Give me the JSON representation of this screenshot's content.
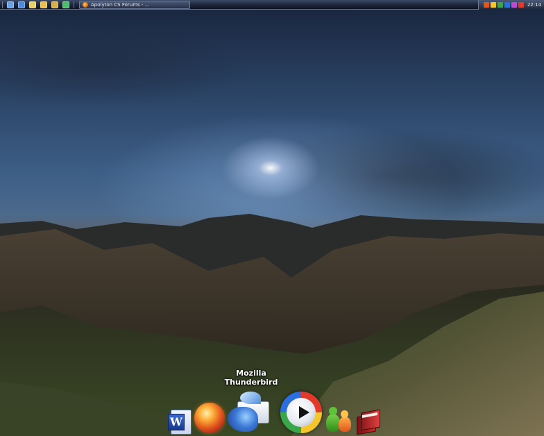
{
  "taskbar": {
    "quick_launch": [
      {
        "name": "show-desktop",
        "color": "#6aa0e8"
      },
      {
        "name": "help",
        "color": "#4a8ae0"
      },
      {
        "name": "folder",
        "color": "#e8d06a"
      },
      {
        "name": "documents",
        "color": "#e8c04a"
      },
      {
        "name": "sync",
        "color": "#d8b04a"
      },
      {
        "name": "security",
        "color": "#4ac06a"
      }
    ],
    "task_button_label": "Apolyton CS Forums - ...",
    "tray_icons": [
      {
        "name": "firefox-tray-icon",
        "color": "#e0561c"
      },
      {
        "name": "winamp-tray-icon",
        "color": "#f5c52a"
      },
      {
        "name": "network-tray-icon",
        "color": "#3aa64a"
      },
      {
        "name": "messenger-tray-icon",
        "color": "#2a6ee0"
      },
      {
        "name": "audio-tray-icon",
        "color": "#c04ad0"
      },
      {
        "name": "security-tray-icon",
        "color": "#e23a2a"
      }
    ],
    "clock": "22:14"
  },
  "dock": {
    "hover_label": "Mozilla Thunderbird",
    "items": [
      {
        "name": "microsoft-word",
        "icon": "word-icon"
      },
      {
        "name": "firefox",
        "icon": "firefox-icon"
      },
      {
        "name": "mozilla-thunderbird",
        "icon": "thunderbird-icon"
      },
      {
        "name": "windows-media-player",
        "icon": "media-player-icon"
      },
      {
        "name": "msn-messenger",
        "icon": "messenger-icon"
      },
      {
        "name": "books",
        "icon": "books-icon"
      }
    ],
    "word_letter": "W"
  }
}
